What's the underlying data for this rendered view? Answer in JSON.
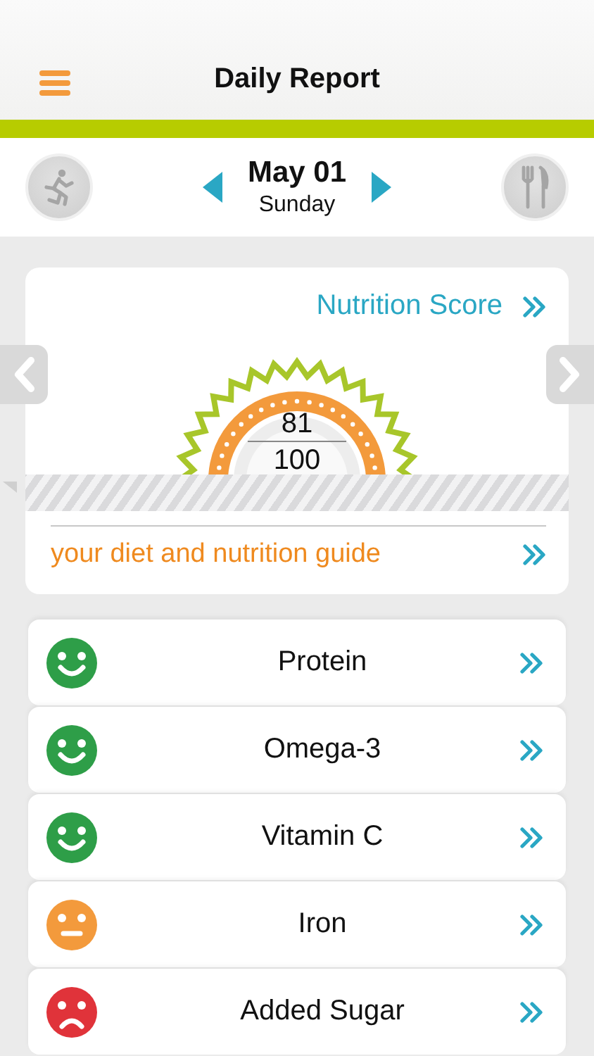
{
  "header": {
    "title": "Daily Report"
  },
  "date": {
    "date": "May 01",
    "weekday": "Sunday"
  },
  "score_card": {
    "title": "Nutrition Score",
    "score": "81",
    "max": "100",
    "guide": "your diet and nutrition guide"
  },
  "nutrients": [
    {
      "name": "Protein",
      "kind": "happy",
      "color": "#2e9e48"
    },
    {
      "name": "Omega-3",
      "kind": "happy",
      "color": "#2e9e48"
    },
    {
      "name": "Vitamin C",
      "kind": "happy",
      "color": "#2e9e48"
    },
    {
      "name": "Iron",
      "kind": "neutral",
      "color": "#f39a3c"
    },
    {
      "name": "Added Sugar",
      "kind": "sad",
      "color": "#e0333a"
    }
  ]
}
